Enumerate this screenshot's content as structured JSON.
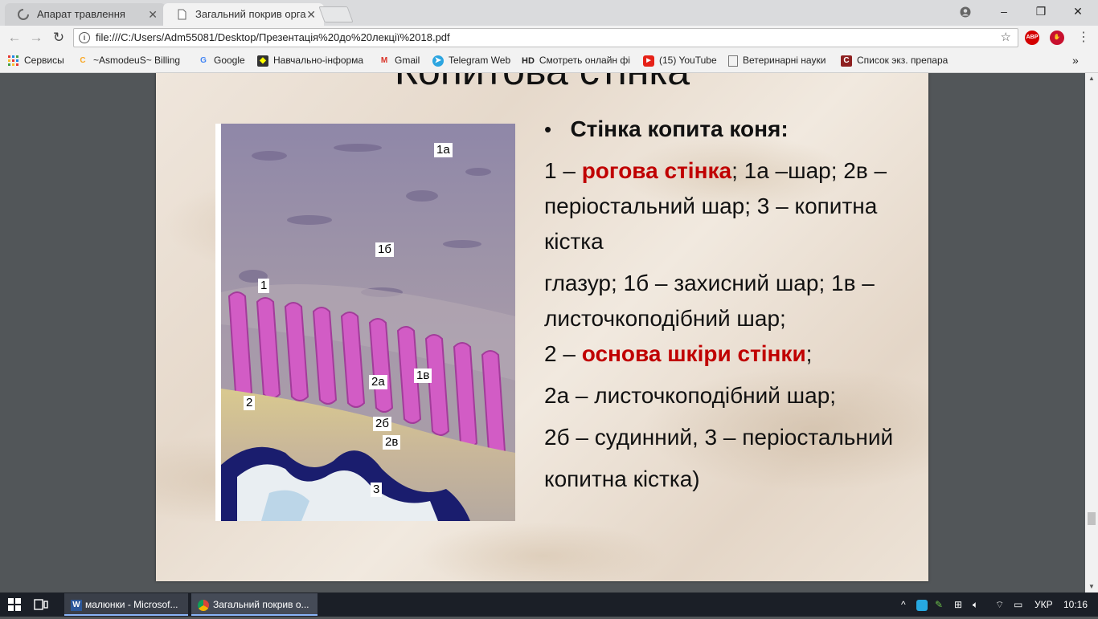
{
  "browser": {
    "tabs": [
      {
        "label": "Апарат травлення",
        "active": false
      },
      {
        "label": "Загальний покрив орга",
        "active": true
      }
    ],
    "address": "file:///C:/Users/Adm55081/Desktop/Презентація%20до%20лекції%2018.pdf",
    "extensions": [
      "ABP"
    ],
    "window_controls": {
      "minimize": "–",
      "maximize": "❐",
      "close": "✕"
    }
  },
  "bookmarks": {
    "apps_label": "Сервисы",
    "items": [
      "~AsmodeuS~ Billing",
      "Google",
      "Навчально-інформа",
      "Gmail",
      "Telegram Web",
      "Смотреть онлайн фі",
      "(15) YouTube",
      "Ветеринарні науки",
      "Список экз. препара"
    ],
    "hd_badge": "HD",
    "more": "»"
  },
  "slide": {
    "title": "Копитова стінка",
    "micro_labels": [
      "1а",
      "1б",
      "1",
      "2а",
      "1в",
      "2",
      "2б",
      "2в",
      "3"
    ],
    "text": {
      "heading": "Стінка копита коня:",
      "p1_a": "1 – ",
      "p1_red": "рогова стінка",
      "p1_b": "; 1а –шар; 2в – періостальний шар; 3 – копитна кістка",
      "p2": "глазур; 1б – захисний шар; 1в – листочкоподібний шар;",
      "p3_a": "2 – ",
      "p3_red": "основа шкіри стінки",
      "p3_b": ";",
      "p4": "2а – листочкоподібний шар;",
      "p5": "2б – судинний, 3 – періостальний",
      "p6": "копитна кістка)"
    }
  },
  "taskbar": {
    "apps": [
      {
        "label": "малюнки - Microsof..."
      },
      {
        "label": "Загальний покрив о..."
      }
    ],
    "lang": "УКР",
    "time": "10:16"
  },
  "colors": {
    "accent_red": "#c00000",
    "tab_bg": "#dadbdd",
    "pdf_bg": "#525659",
    "taskbar": "#1b1f27"
  }
}
